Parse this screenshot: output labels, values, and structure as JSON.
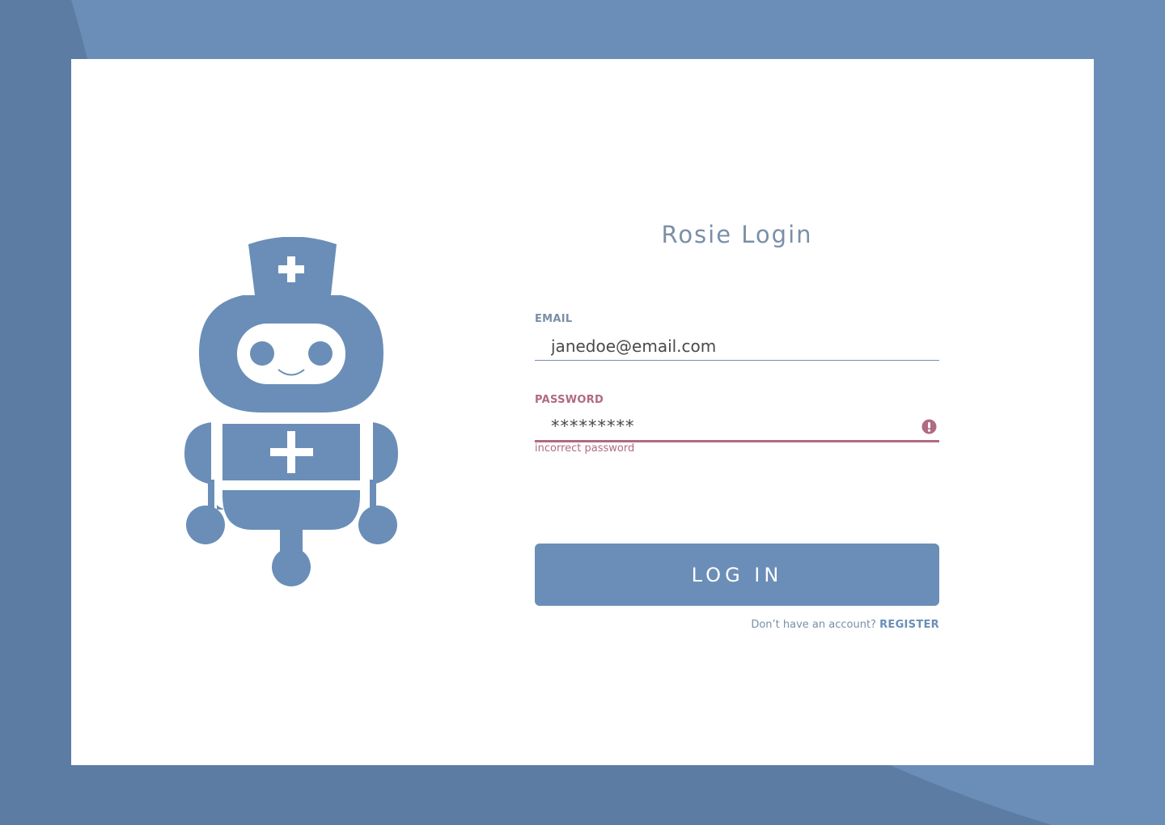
{
  "title": "Rosie Login",
  "email": {
    "label": "EMAIL",
    "value": "janedoe@email.com"
  },
  "password": {
    "label": "PASSWORD",
    "value": "*********",
    "error": "incorrect password"
  },
  "login_button": "LOG IN",
  "register": {
    "prompt": "Don’t have an account?",
    "link": "REGISTER"
  },
  "colors": {
    "background": "#6a8eb7",
    "background_dark": "#5c7ca3",
    "card": "#ffffff",
    "accent": "#6a8eb7",
    "label": "#7a8fa7",
    "error": "#b06a84"
  },
  "icons": {
    "mascot": "nurse-robot-icon",
    "error": "alert-circle-icon"
  }
}
